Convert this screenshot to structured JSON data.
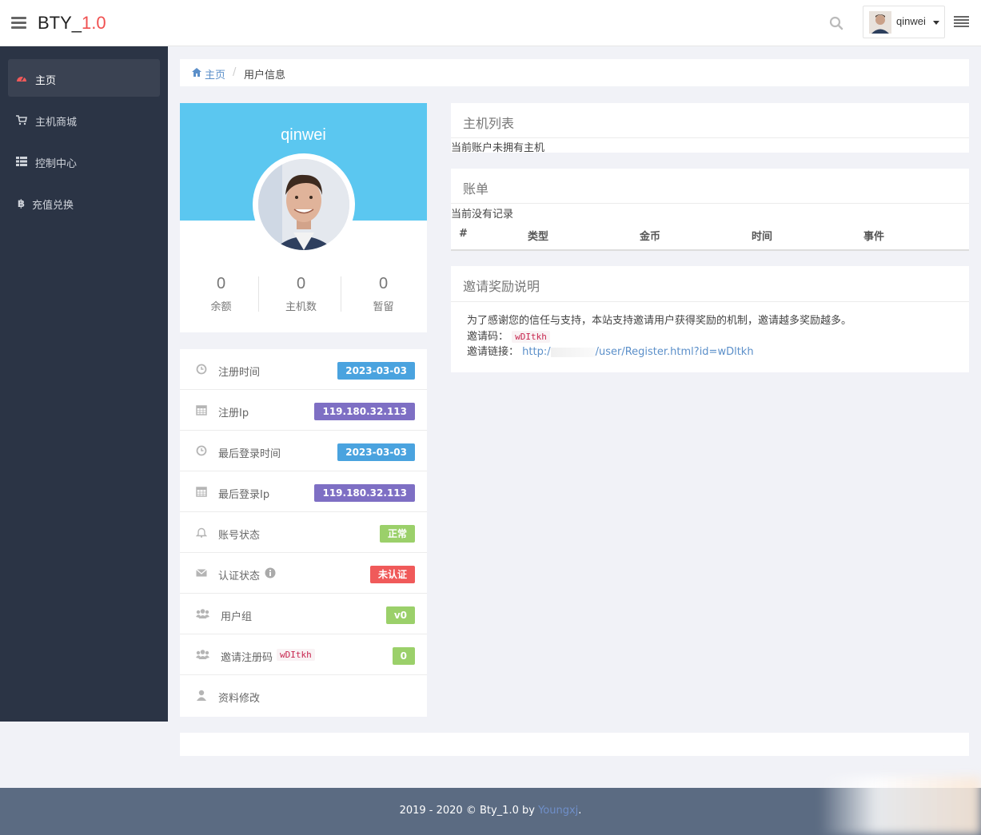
{
  "header": {
    "brand_prefix": "BTY_",
    "brand_version": "1.0",
    "username": "qinwei",
    "icons": [
      "menu-icon",
      "search-icon",
      "caret-down-icon",
      "list-icon"
    ]
  },
  "sidebar": {
    "items": [
      {
        "label": "主页",
        "icon": "dashboard-icon",
        "active": true
      },
      {
        "label": "主机商城",
        "icon": "cart-icon",
        "active": false
      },
      {
        "label": "控制中心",
        "icon": "table-icon",
        "active": false
      },
      {
        "label": "充值兑换",
        "icon": "bitcoin-icon",
        "active": false
      }
    ]
  },
  "breadcrumb": {
    "home": "主页",
    "separator": "/",
    "current": "用户信息"
  },
  "profile": {
    "name": "qinwei",
    "stats": [
      {
        "value": "0",
        "label": "余额"
      },
      {
        "value": "0",
        "label": "主机数"
      },
      {
        "value": "0",
        "label": "暂留"
      }
    ]
  },
  "info": {
    "rows": [
      {
        "label": "注册时间",
        "value": "2023-03-03",
        "color": "#4aa3df",
        "icon": "clock-icon"
      },
      {
        "label": "注册Ip",
        "value": "119.180.32.113",
        "color": "#7e6fc4",
        "icon": "calendar-icon"
      },
      {
        "label": "最后登录时间",
        "value": "2023-03-03",
        "color": "#4aa3df",
        "icon": "clock-icon"
      },
      {
        "label": "最后登录Ip",
        "value": "119.180.32.113",
        "color": "#7e6fc4",
        "icon": "calendar-icon"
      },
      {
        "label": "账号状态",
        "value": "正常",
        "color": "#9bd06a",
        "icon": "bell-icon"
      },
      {
        "label": "认证状态",
        "value": "未认证",
        "color": "#f05a5a",
        "icon": "envelope-icon"
      },
      {
        "label": "用户组",
        "value": "v0",
        "color": "#9bd06a",
        "icon": "users-icon"
      },
      {
        "label": "邀请注册码",
        "value": "0",
        "color": "#9bd06a",
        "icon": "users-icon",
        "code": "wDItkh"
      },
      {
        "label": "资料修改",
        "icon": "user-icon"
      }
    ]
  },
  "hosts": {
    "title": "主机列表",
    "empty": "当前账户未拥有主机"
  },
  "bills": {
    "title": "账单",
    "empty": "当前没有记录",
    "columns": [
      "#",
      "类型",
      "金币",
      "时间",
      "事件"
    ]
  },
  "invite": {
    "title": "邀请奖励说明",
    "desc": "为了感谢您的信任与支持，本站支持邀请用户获得奖励的机制，邀请越多奖励越多。",
    "code_label": "邀请码：",
    "code": "wDItkh",
    "link_label": "邀请链接：",
    "link_prefix": "http:/",
    "link_suffix": "/user/Register.html?id=wDltkh"
  },
  "footer": {
    "text": "2019 - 2020 © Bty_1.0 by ",
    "author": "Youngxj",
    "end": "."
  }
}
